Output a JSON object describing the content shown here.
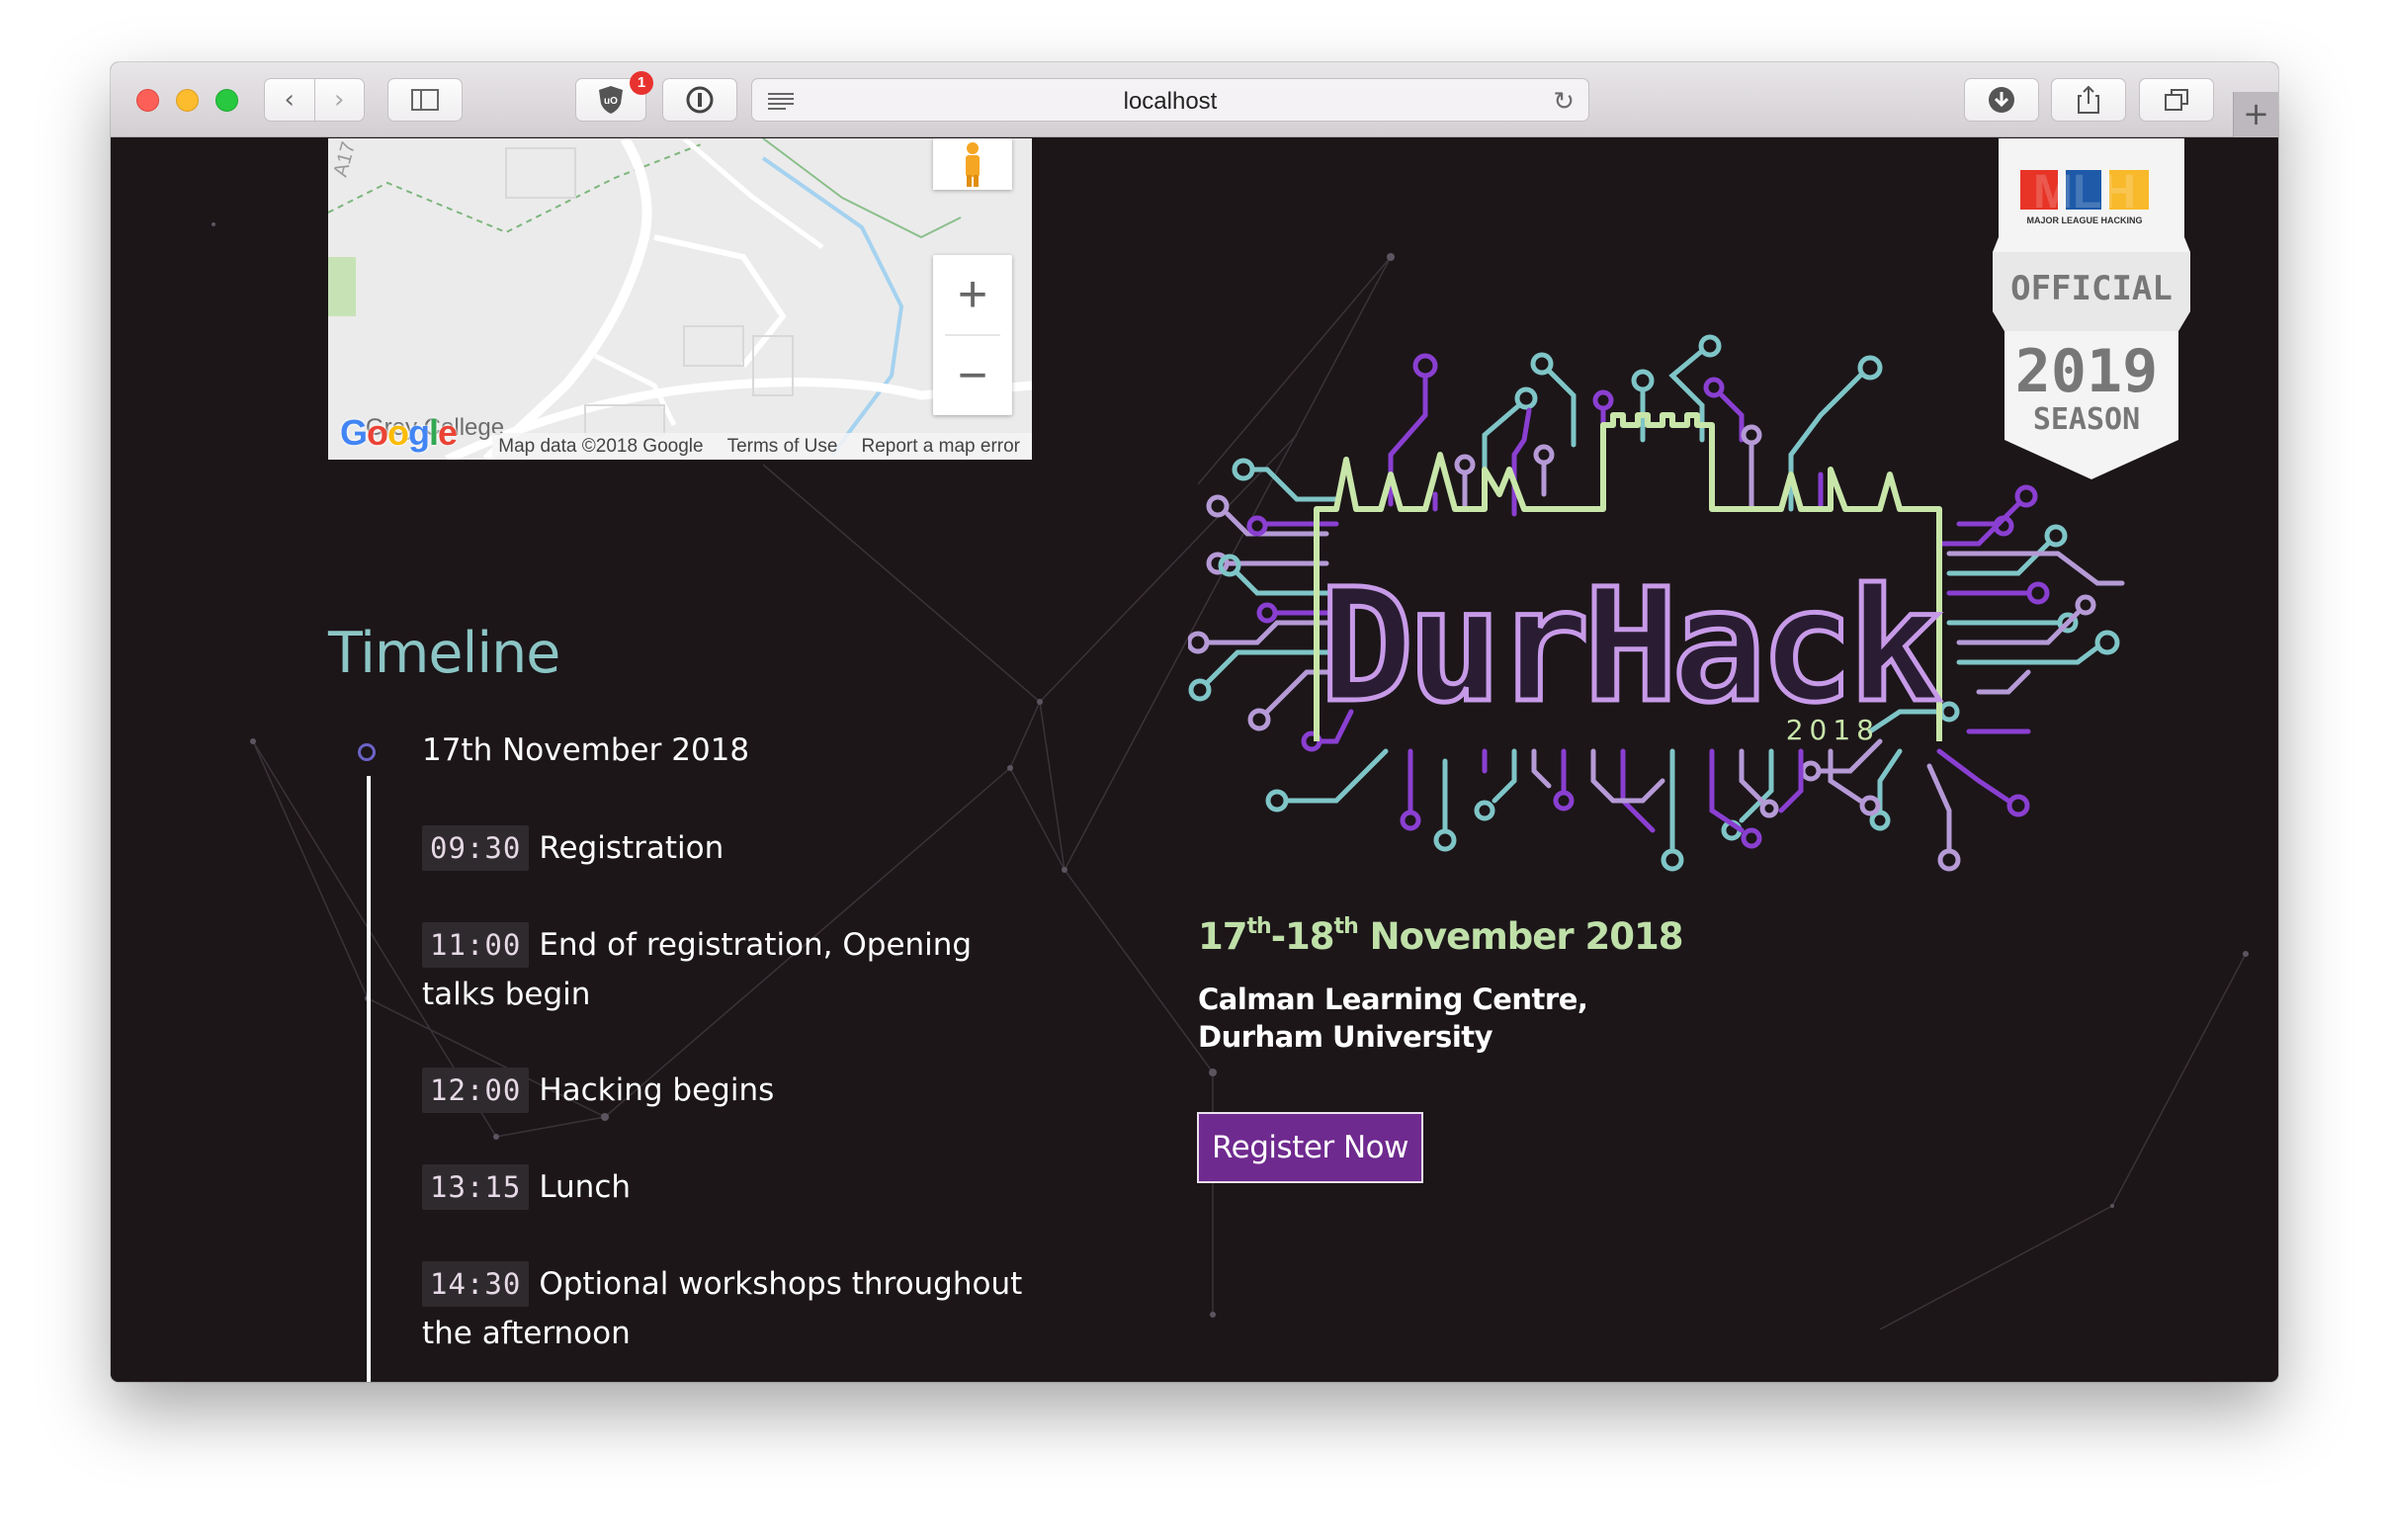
{
  "browser": {
    "url": "localhost",
    "ublock_badge": "1"
  },
  "map": {
    "place_label": "Grey College",
    "google_logo": "Google",
    "attribution": {
      "data": "Map data ©2018 Google",
      "terms": "Terms of Use",
      "report": "Report a map error"
    },
    "zoom_in": "+",
    "zoom_out": "−",
    "road_label": "A17"
  },
  "timeline": {
    "title": "Timeline",
    "date": "17th November 2018",
    "items": [
      {
        "time": "09:30",
        "label": "Registration"
      },
      {
        "time": "11:00",
        "label": "End of registration, Opening talks begin"
      },
      {
        "time": "12:00",
        "label": "Hacking begins"
      },
      {
        "time": "13:15",
        "label": "Lunch"
      },
      {
        "time": "14:30",
        "label": "Optional workshops throughout the afternoon"
      }
    ]
  },
  "event": {
    "logo_text": "DurHack",
    "logo_year": "2018",
    "date_start": "17",
    "date_start_suffix": "th",
    "date_end": "18",
    "date_end_suffix": "th",
    "date_rest": "November 2018",
    "venue_line1": "Calman Learning Centre,",
    "venue_line2": "Durham University",
    "register_label": "Register Now"
  },
  "mlh_badge": {
    "letters": "MLH",
    "subtitle": "MAJOR LEAGUE HACKING",
    "official": "OFFICIAL",
    "year": "2019",
    "season": "SEASON"
  },
  "colors": {
    "background": "#1c1619",
    "timeline_title": "#8cc5c5",
    "event_date": "#bfe0a9",
    "register_button": "#6f2a8f",
    "circuit_purple": "#8a3fd1",
    "circuit_teal": "#7fc5c7",
    "circuit_lavender": "#b59ad6",
    "circuit_green": "#c8e6a9"
  }
}
